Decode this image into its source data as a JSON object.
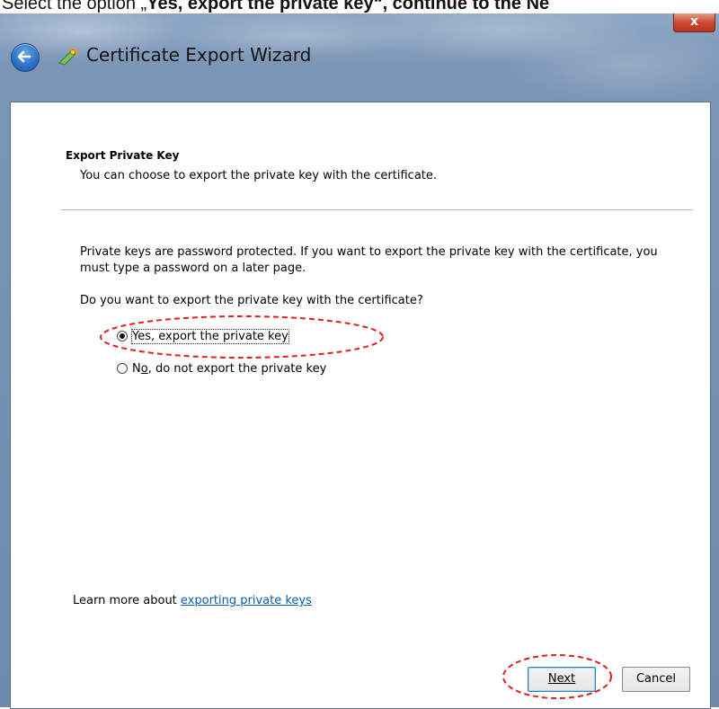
{
  "caption": {
    "prefix": "Select the option „",
    "bold": "Yes, export the private key",
    "suffix": "“, continue to the ",
    "cut": "Ne"
  },
  "window": {
    "title": "Certificate Export Wizard",
    "close_label": "x"
  },
  "page": {
    "section_title": "Export Private Key",
    "section_desc": "You can choose to export the private key with the certificate.",
    "body_text": "Private keys are password protected. If you want to export the private key with the certificate, you must type a password on a later page.",
    "question": "Do you want to export the private key with the certificate?"
  },
  "options": {
    "yes": {
      "label": "Yes, export the private key",
      "checked": true
    },
    "no": {
      "label_pre": "N",
      "label_access": "o",
      "label_post": ", do not export the private key",
      "checked": false
    }
  },
  "learn_more": {
    "prefix": "Learn more about ",
    "link": "exporting private keys"
  },
  "buttons": {
    "next": "Next",
    "cancel": "Cancel"
  },
  "colors": {
    "annotation": "#e02020",
    "link": "#0b5cad"
  }
}
